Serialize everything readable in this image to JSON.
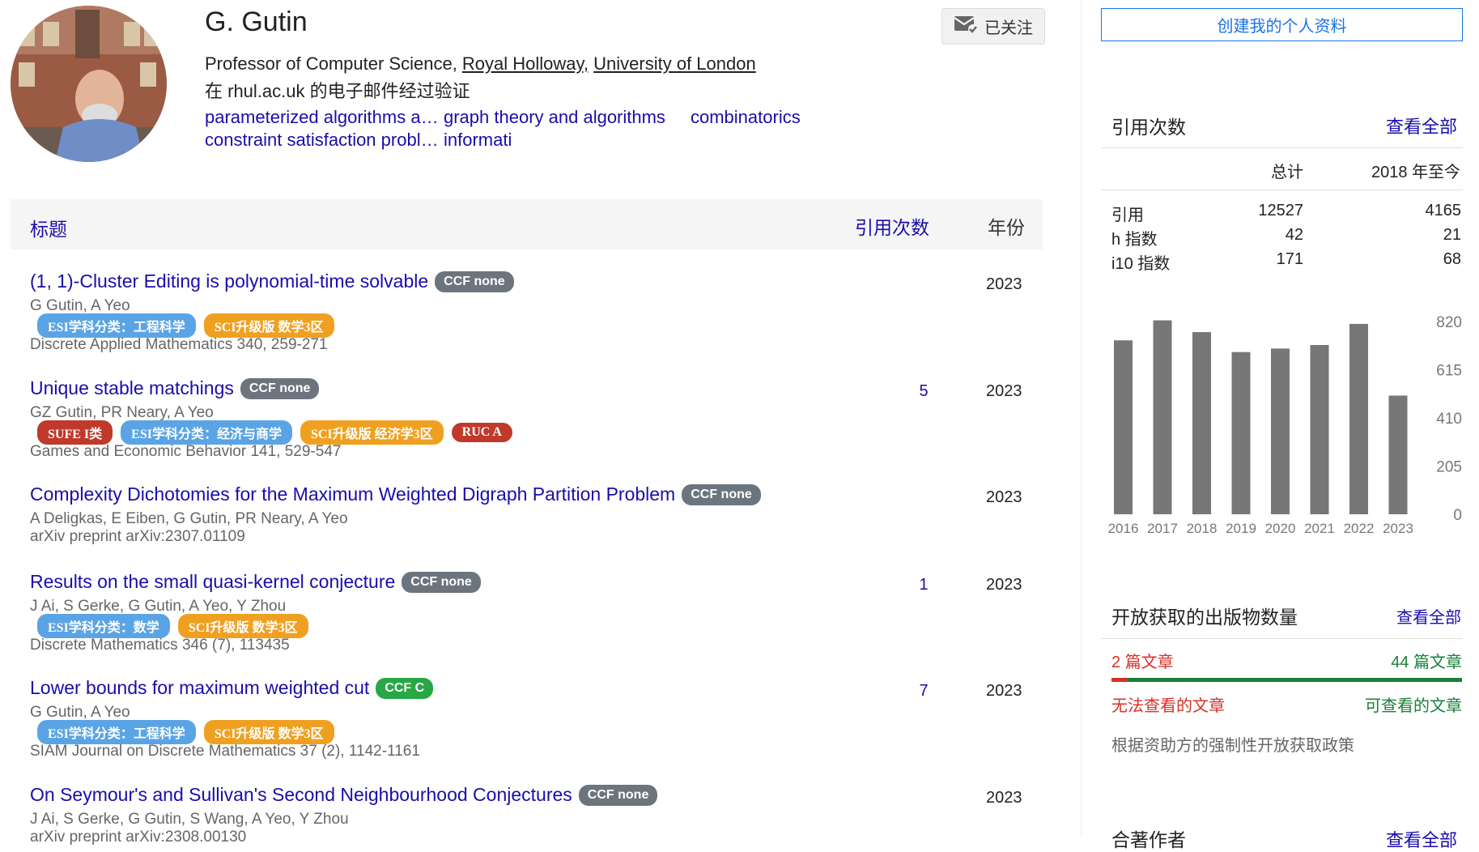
{
  "profile": {
    "name": "G. Gutin",
    "follow_label": "已关注",
    "affiliation_prefix": "Professor of Computer Science, ",
    "affiliation_link1": "Royal Holloway,",
    "affiliation_link2": "University of London",
    "verified": "在 rhul.ac.uk 的电子邮件经过验证",
    "interests": [
      "parameterized algorithms a…",
      "graph theory and algorithms",
      "combinatorics",
      "constraint satisfaction probl…",
      "informati"
    ]
  },
  "table": {
    "col_title": "标题",
    "col_cited": "引用次数",
    "col_year": "年份"
  },
  "articles": [
    {
      "title": "(1, 1)-Cluster Editing is polynomial-time solvable",
      "ccf": "CCF none",
      "authors": "G Gutin, A Yeo",
      "tags": [
        {
          "label": "ESI学科分类：工程科学",
          "color": "blue"
        },
        {
          "label": "SCI升级版 数学3区",
          "color": "orange"
        }
      ],
      "venue": "Discrete Applied Mathematics 340, 259-271",
      "cited": "",
      "year": "2023"
    },
    {
      "title": "Unique stable matchings",
      "ccf": "CCF none",
      "authors": "GZ Gutin, PR Neary, A Yeo",
      "tags": [
        {
          "label": "SUFE I类",
          "color": "red"
        },
        {
          "label": "ESI学科分类：经济与商学",
          "color": "blue"
        },
        {
          "label": "SCI升级版 经济学3区",
          "color": "orange"
        },
        {
          "label": "RUC A",
          "color": "red"
        }
      ],
      "venue": "Games and Economic Behavior 141, 529-547",
      "cited": "5",
      "year": "2023"
    },
    {
      "title": "Complexity Dichotomies for the Maximum Weighted Digraph Partition Problem",
      "ccf": "CCF none",
      "authors": "A Deligkas, E Eiben, G Gutin, PR Neary, A Yeo",
      "tags": [],
      "venue": "arXiv preprint arXiv:2307.01109",
      "cited": "",
      "year": "2023"
    },
    {
      "title": "Results on the small quasi-kernel conjecture",
      "ccf": "CCF none",
      "authors": "J Ai, S Gerke, G Gutin, A Yeo, Y Zhou",
      "tags": [
        {
          "label": "ESI学科分类：数学",
          "color": "blue"
        },
        {
          "label": "SCI升级版 数学3区",
          "color": "orange"
        }
      ],
      "venue": "Discrete Mathematics 346 (7), 113435",
      "cited": "1",
      "year": "2023"
    },
    {
      "title": "Lower bounds for maximum weighted cut",
      "ccf": "CCF C",
      "authors": "G Gutin, A Yeo",
      "tags": [
        {
          "label": "ESI学科分类：工程科学",
          "color": "blue"
        },
        {
          "label": "SCI升级版 数学3区",
          "color": "orange"
        }
      ],
      "venue": "SIAM Journal on Discrete Mathematics 37 (2), 1142-1161",
      "cited": "7",
      "year": "2023"
    },
    {
      "title": "On Seymour's and Sullivan's Second Neighbourhood Conjectures",
      "ccf": "CCF none",
      "authors": "J Ai, S Gerke, G Gutin, S Wang, A Yeo, Y Zhou",
      "tags": [],
      "venue": "arXiv preprint arXiv:2308.00130",
      "cited": "",
      "year": "2023"
    }
  ],
  "sidebar": {
    "create_profile": "创建我的个人资料",
    "citations_title": "引用次数",
    "view_all": "查看全部",
    "col_total": "总计",
    "col_since": "2018 年至今",
    "stats": [
      {
        "label": "引用",
        "total": "12527",
        "since": "4165"
      },
      {
        "label": "h 指数",
        "total": "42",
        "since": "21"
      },
      {
        "label": "i10 指数",
        "total": "171",
        "since": "68"
      }
    ],
    "oa_title": "开放获取的出版物数量",
    "oa_view_all": "查看全部",
    "oa_unavailable_count": "2 篇文章",
    "oa_available_count": "44 篇文章",
    "oa_unavailable_label": "无法查看的文章",
    "oa_available_label": "可查看的文章",
    "oa_fraction_unavailable": 0.043,
    "oa_policy": "根据资助方的强制性开放获取政策",
    "coauthors_title": "合著作者",
    "coauthors_view_all": "查看全部"
  },
  "chart_data": {
    "type": "bar",
    "categories": [
      "2016",
      "2017",
      "2018",
      "2019",
      "2020",
      "2021",
      "2022",
      "2023"
    ],
    "values": [
      740,
      825,
      775,
      690,
      705,
      720,
      810,
      505
    ],
    "yticks": [
      "820",
      "615",
      "410",
      "205",
      "0"
    ],
    "ylim": [
      0,
      820
    ],
    "bar_color": "#777777"
  }
}
